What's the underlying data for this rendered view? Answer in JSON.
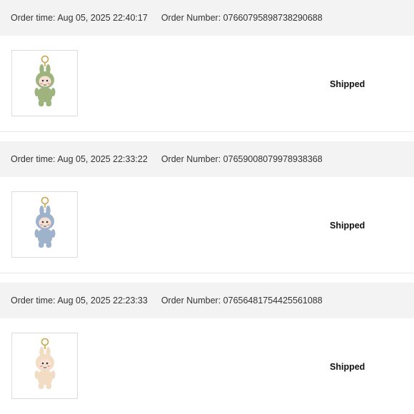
{
  "orders": [
    {
      "order_time_label": "Order time:",
      "order_time": "Aug 05, 2025 22:40:17",
      "order_number_label": "Order Number:",
      "order_number": "07660795898738290688",
      "status": "Shipped",
      "product_icon": "plush-keychain-icon",
      "product_color": "#9fb37f"
    },
    {
      "order_time_label": "Order time:",
      "order_time": "Aug 05, 2025 22:33:22",
      "order_number_label": "Order Number:",
      "order_number": "07659008079978938368",
      "status": "Shipped",
      "product_icon": "plush-keychain-icon",
      "product_color": "#9fb2cc"
    },
    {
      "order_time_label": "Order time:",
      "order_time": "Aug 05, 2025 22:23:33",
      "order_number_label": "Order Number:",
      "order_number": "07656481754425561088",
      "status": "Shipped",
      "product_icon": "plush-keychain-icon",
      "product_color": "#f3dcc4"
    }
  ]
}
